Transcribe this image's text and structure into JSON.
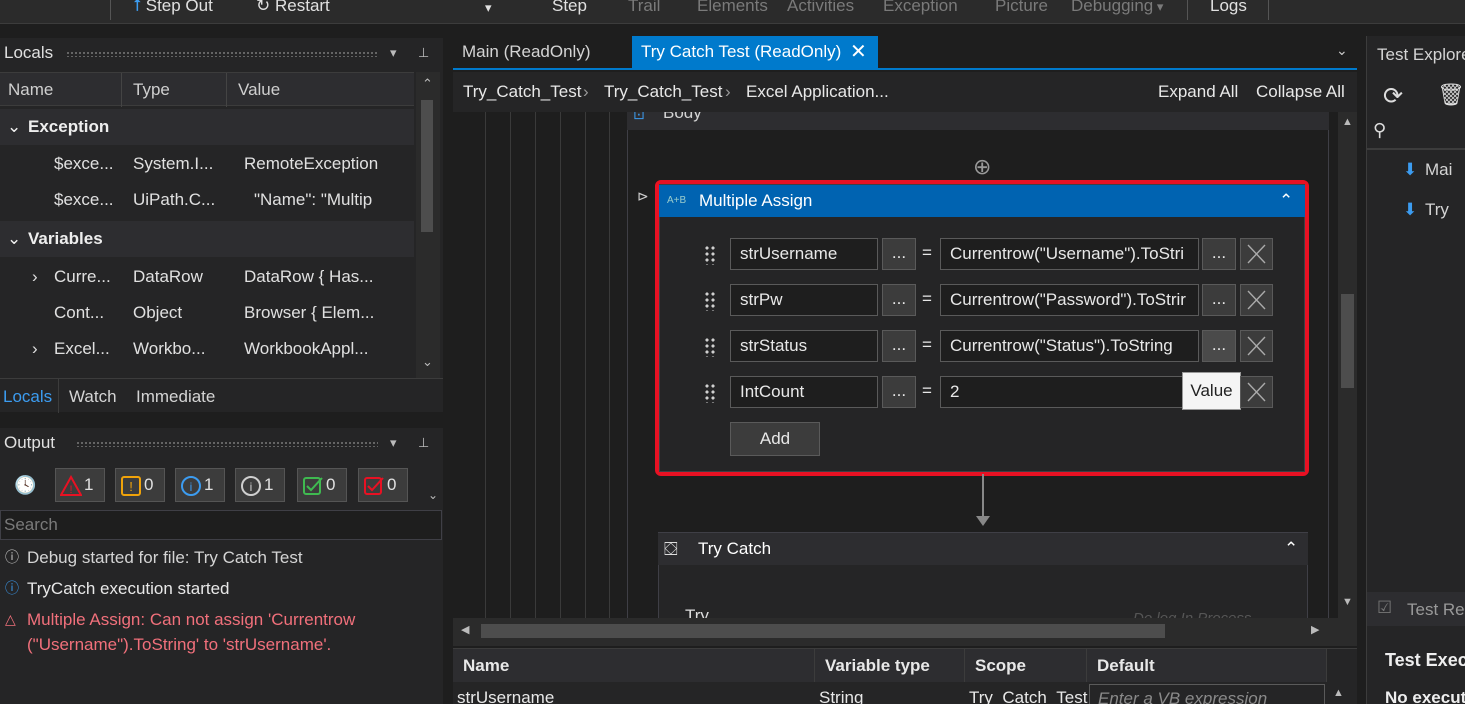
{
  "toolbar": {
    "step_out": "Step Out",
    "restart": "Restart",
    "step": "Step",
    "trail": "Trail",
    "elements": "Elements",
    "activities": "Activities",
    "exception": "Exception",
    "picture": "Picture",
    "debugging": "Debugging",
    "logs": "Logs"
  },
  "locals": {
    "title": "Locals",
    "columns": [
      "Name",
      "Type",
      "Value"
    ],
    "groups": [
      {
        "label": "Exception",
        "rows": [
          {
            "name": "$exce...",
            "type": "System.I...",
            "value": "RemoteException"
          },
          {
            "name": "$exce...",
            "type": "UiPath.C...",
            "value": "\"Name\": \"Multip"
          }
        ]
      },
      {
        "label": "Variables",
        "rows": [
          {
            "name": "Curre...",
            "type": "DataRow",
            "value": "DataRow { Has..."
          },
          {
            "name": "Cont...",
            "type": "Object",
            "value": "Browser { Elem..."
          },
          {
            "name": "Excel...",
            "type": "Workbo...",
            "value": "WorkbookAppl..."
          }
        ]
      }
    ],
    "tabs": [
      "Locals",
      "Watch",
      "Immediate"
    ]
  },
  "output": {
    "title": "Output",
    "filters": [
      {
        "kind": "error",
        "count": "1"
      },
      {
        "kind": "warning",
        "count": "0"
      },
      {
        "kind": "info",
        "count": "1"
      },
      {
        "kind": "trace",
        "count": "1"
      },
      {
        "kind": "success",
        "count": "0"
      },
      {
        "kind": "failure",
        "count": "0"
      }
    ],
    "search_placeholder": "Search",
    "logs": [
      {
        "level": "trace",
        "text": "Debug started for file: Try Catch Test"
      },
      {
        "level": "info",
        "text": "TryCatch execution started"
      },
      {
        "level": "error",
        "text": "Multiple Assign: Can not assign 'Currentrow (\"Username\").ToString' to 'strUsername'."
      }
    ]
  },
  "designer": {
    "tabs": [
      "Main (ReadOnly)",
      "Try Catch Test (ReadOnly)"
    ],
    "breadcrumb": [
      "Try_Catch_Test",
      "Try_Catch_Test",
      "Excel Application..."
    ],
    "expand_all": "Expand All",
    "collapse_all": "Collapse All",
    "body_label": "Body",
    "multiple_assign": {
      "title": "Multiple Assign",
      "rows": [
        {
          "to": "strUsername",
          "value": "Currentrow(\"Username\").ToStri"
        },
        {
          "to": "strPw",
          "value": "Currentrow(\"Password\").ToStrir"
        },
        {
          "to": "strStatus",
          "value": "Currentrow(\"Status\").ToString"
        },
        {
          "to": "IntCount",
          "value": "2"
        }
      ],
      "ellipsis": "...",
      "equals": "=",
      "tooltip": "Value",
      "add_label": "Add"
    },
    "try_catch": {
      "title": "Try Catch",
      "try_label": "Try",
      "inner_hint": "Do log In Process"
    }
  },
  "variables": {
    "columns": [
      "Name",
      "Variable type",
      "Scope",
      "Default"
    ],
    "rows": [
      {
        "name": "strUsername",
        "type": "String",
        "scope": "Try_Catch_Test",
        "default": "Enter a VB expression"
      }
    ]
  },
  "right_panel": {
    "title": "Test Explore",
    "items": [
      "Mai",
      "Try"
    ],
    "results_title": "Test Res",
    "exec_title": "Test Exec",
    "no_exec": "No execut"
  },
  "colors": {
    "accent": "#007acc",
    "selection": "#e81123",
    "error_text": "#f1707b"
  }
}
